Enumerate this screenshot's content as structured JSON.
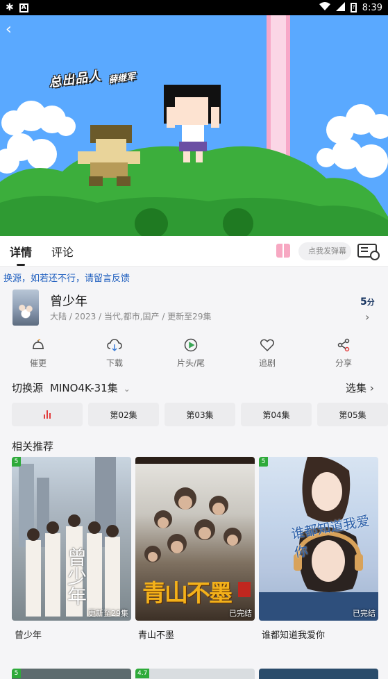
{
  "status_bar": {
    "time": "8:39",
    "left_icons": [
      "app-icon",
      "a-icon"
    ],
    "right_icons": [
      "wifi-icon",
      "signal-icon",
      "battery-icon"
    ]
  },
  "player": {
    "overlay_text_1": "总出品人",
    "overlay_text_2": "薛继军",
    "colors": {
      "sky": "#5aa9ff",
      "grass": "#3cae3c",
      "dark_grass": "#1f7a22"
    }
  },
  "tabs": [
    {
      "label": "详情",
      "active": true
    },
    {
      "label": "评论",
      "active": false
    }
  ],
  "danmu": {
    "placeholder": "点我发弹幕"
  },
  "notice": "换源，如若还不行，请留言反馈",
  "show": {
    "title": "曾少年",
    "meta": "大陆 / 2023 / 当代,都市,国产 / 更新至29集",
    "score": "5",
    "score_unit": "分"
  },
  "actions": [
    {
      "label": "催更",
      "icon": "bell-icon"
    },
    {
      "label": "下载",
      "icon": "cloud-download-icon"
    },
    {
      "label": "片头/尾",
      "icon": "play-circle-icon"
    },
    {
      "label": "追剧",
      "icon": "heart-icon"
    },
    {
      "label": "分享",
      "icon": "share-icon"
    }
  ],
  "source": {
    "label": "切换源",
    "name": "MINO4K-31集",
    "episodes_link": "选集"
  },
  "episodes": [
    "",
    "第02集",
    "第03集",
    "第04集",
    "第05集"
  ],
  "related": {
    "title": "相关推荐",
    "items": [
      {
        "title": "曾少年",
        "badge": "5",
        "status": "更新至29集",
        "poster_text": "曾少年"
      },
      {
        "title": "青山不墨",
        "badge": "",
        "status": "已完结",
        "poster_text": "青山不墨"
      },
      {
        "title": "谁都知道我爱你",
        "badge": "5",
        "status": "已完结",
        "poster_text": "谁都知道我爱你"
      }
    ],
    "next_row_badges": [
      "5",
      "4.7",
      ""
    ]
  },
  "accent_colors": {
    "notice": "#1f5fbf",
    "badge": "#2eaa3a",
    "playing": "#e23c3c"
  }
}
